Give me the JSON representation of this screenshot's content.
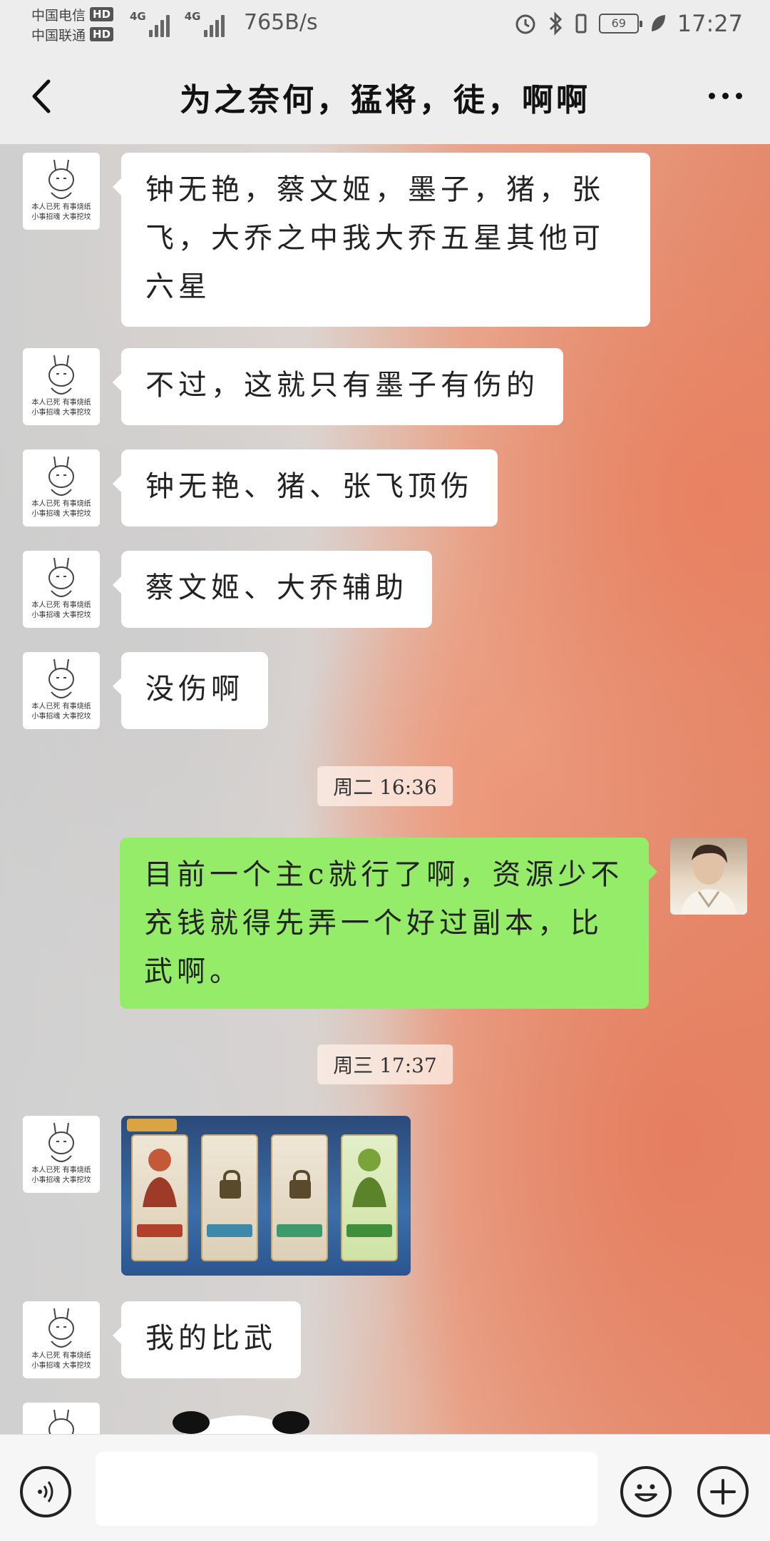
{
  "status_bar": {
    "carrier1": "中国电信",
    "carrier2": "中国联通",
    "hd_label": "HD",
    "net1": "4G",
    "net2": "4G",
    "net_speed": "765B/s",
    "battery": "69",
    "time": "17:27"
  },
  "header": {
    "title": "为之奈何，猛将，徒，啊啊"
  },
  "avatar_caption": [
    "本人已死 有事烧纸",
    "小事招魂 大事挖坟"
  ],
  "messages": [
    {
      "text": "钟无艳，蔡文姬，墨子，猪，张飞，大乔之中我大乔五星其他可六星"
    },
    {
      "text": "不过，这就只有墨子有伤的"
    },
    {
      "text": "钟无艳、猪、张飞顶伤"
    },
    {
      "text": "蔡文姬、大乔辅助"
    },
    {
      "text": "没伤啊"
    },
    {
      "text": "目前一个主c就行了啊，资源少不充钱就得先弄一个好过副本，比武啊。"
    },
    {
      "text": "我的比武"
    }
  ],
  "timestamps": [
    "周二 16:36",
    "周三 17:37"
  ],
  "colors": {
    "self_bubble": "#95ec69",
    "other_bubble": "#ffffff",
    "bar_bg": "#ededed"
  },
  "icons": {
    "back": "chevron-left-icon",
    "more": "more-dots-icon",
    "voice": "voice-icon",
    "emoji": "emoji-icon",
    "plus": "plus-icon"
  }
}
